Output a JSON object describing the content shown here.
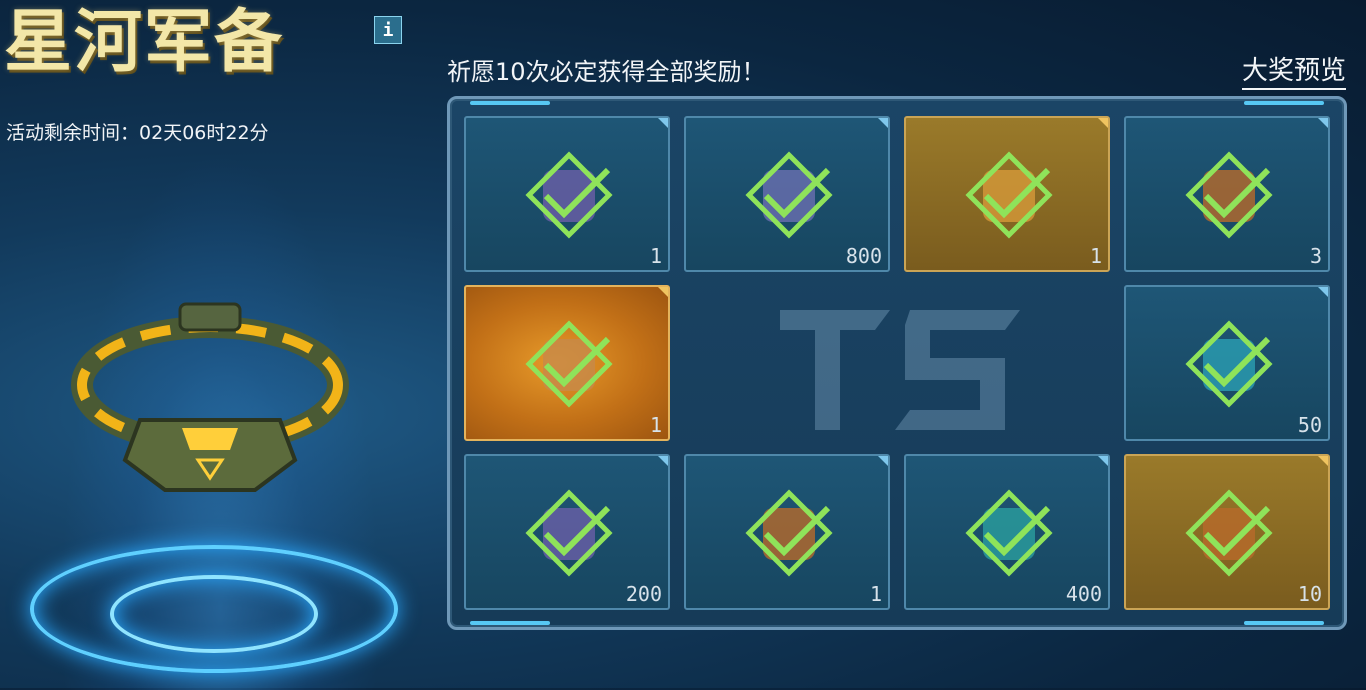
{
  "header": {
    "title": "星河军备",
    "info_label": "i",
    "timer_label": "活动剩余时间：",
    "timer_value": "02天06时22分"
  },
  "board": {
    "notice": "祈愿10次必定获得全部奖励！",
    "preview_label": "大奖预览",
    "rewards": [
      {
        "qty": "1",
        "style": "blue",
        "art": "#6b5fa8"
      },
      {
        "qty": "800",
        "style": "blue",
        "art": "#6a6fb0"
      },
      {
        "qty": "1",
        "style": "gold",
        "art": "#d69a3a"
      },
      {
        "qty": "3",
        "style": "blue",
        "art": "#b86a2a"
      },
      {
        "qty": "1",
        "style": "orange",
        "art": "#c78a4a"
      },
      {
        "qty": "50",
        "style": "blue",
        "art": "#2a9fb3"
      },
      {
        "qty": "200",
        "style": "blue",
        "art": "#6a5fa8"
      },
      {
        "qty": "1",
        "style": "blue",
        "art": "#b86a2a"
      },
      {
        "qty": "400",
        "style": "blue",
        "art": "#2a9f9f"
      },
      {
        "qty": "10",
        "style": "gold",
        "art": "#b86a2a"
      }
    ]
  },
  "colors": {
    "check": "#8fe35a",
    "accent": "#57c8f4",
    "title": "#f3e7a8"
  }
}
